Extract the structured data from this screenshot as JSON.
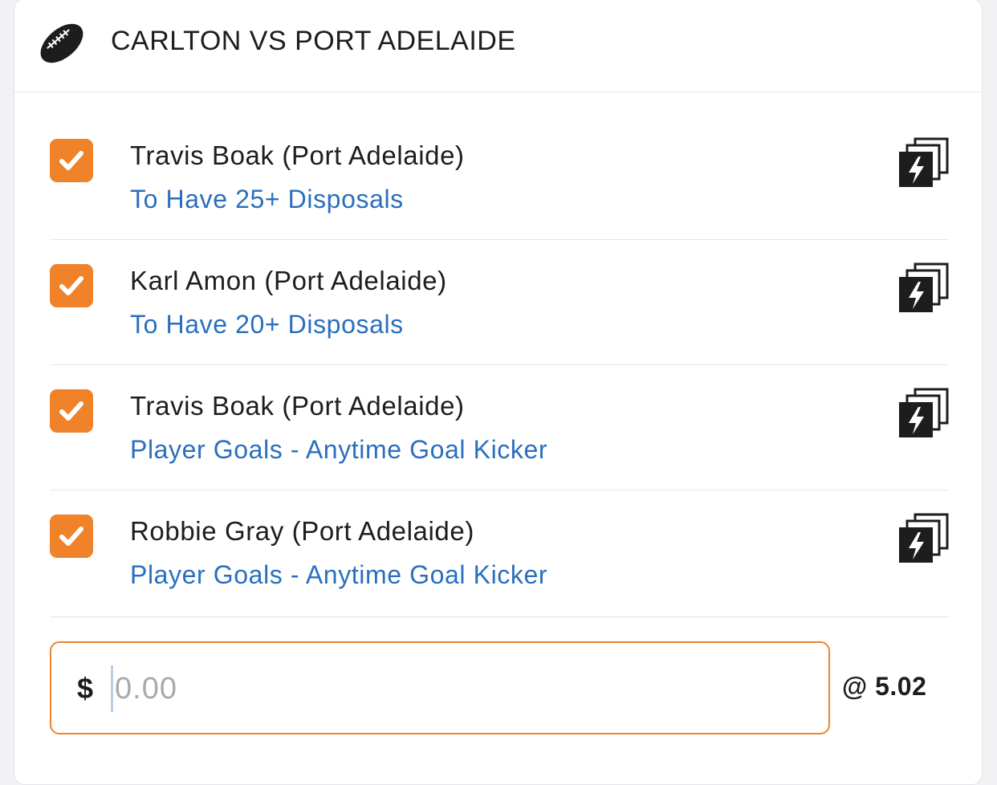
{
  "match": {
    "title": "CARLTON VS PORT ADELAIDE",
    "icon": "football-icon"
  },
  "legs": [
    {
      "player": "Travis Boak (Port Adelaide)",
      "market": "To Have 25+ Disposals",
      "checked": true
    },
    {
      "player": "Karl Amon (Port Adelaide)",
      "market": "To Have 20+ Disposals",
      "checked": true
    },
    {
      "player": "Travis Boak (Port Adelaide)",
      "market": "Player Goals - Anytime Goal Kicker",
      "checked": true
    },
    {
      "player": "Robbie Gray (Port Adelaide)",
      "market": "Player Goals - Anytime Goal Kicker",
      "checked": true
    }
  ],
  "stake": {
    "currency": "$",
    "placeholder": "0.00",
    "value": ""
  },
  "odds": "@ 5.02",
  "colors": {
    "accent": "#f0822a",
    "link": "#2a6fbd",
    "text": "#1d1d1f"
  }
}
